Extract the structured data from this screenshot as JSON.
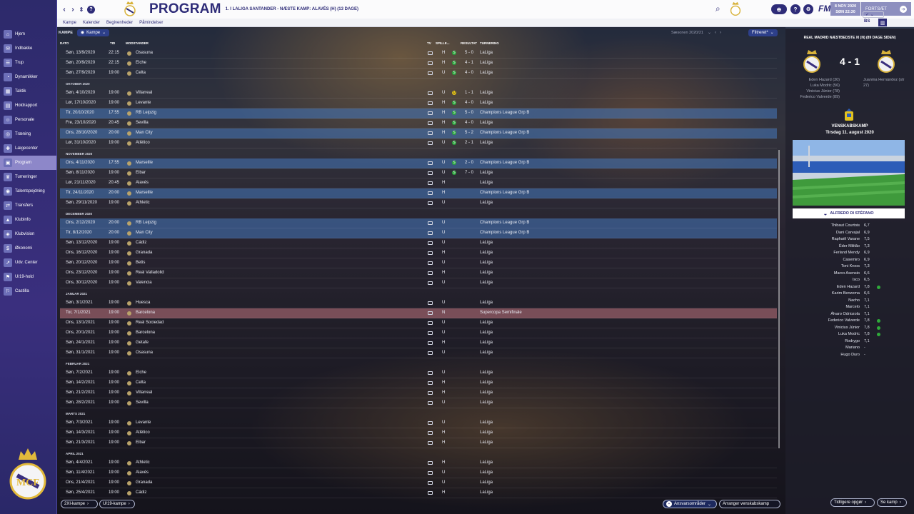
{
  "header": {
    "title": "PROGRAM",
    "subtitle": "1. I LALIGA SANTANDER - NÆSTE KAMP: ALAVÉS (H) (13 DAGE)",
    "date_line1": "8 NOV 2020",
    "date_line2": "SØN 22:30",
    "continue_label": "FORTSÆT",
    "fm_label": "FM",
    "bs_label": "BS"
  },
  "subnav": [
    "Kampe",
    "Kalender",
    "Begivenheder",
    "Påmindelser"
  ],
  "toolbar": {
    "kampe_label": "KAMPE",
    "kampe_dropdown": "Kampe",
    "season": "Sæsonen 2020/21",
    "filter": "Filtreret*"
  },
  "columns": {
    "date": "DATO",
    "time": "TID",
    "opponent": "MODSTANDER",
    "tv": "TV",
    "venue": "SPILLE...",
    "result": "RESULTAT",
    "comp": "TURNERING"
  },
  "sidebar": [
    {
      "label": "Hjem",
      "icon": "home-icon"
    },
    {
      "label": "Indbakke",
      "icon": "inbox-icon"
    },
    {
      "label": "Trup",
      "icon": "squad-icon"
    },
    {
      "label": "Dynamikker",
      "icon": "dynamics-icon"
    },
    {
      "label": "Taktik",
      "icon": "tactics-icon"
    },
    {
      "label": "Holdrapport",
      "icon": "report-icon"
    },
    {
      "label": "Personale",
      "icon": "staff-icon"
    },
    {
      "label": "Træning",
      "icon": "training-icon"
    },
    {
      "label": "Lægecenter",
      "icon": "medical-icon"
    },
    {
      "label": "Program",
      "icon": "calendar-icon"
    },
    {
      "label": "Turneringer",
      "icon": "trophy-icon"
    },
    {
      "label": "Talentspejdning",
      "icon": "scouting-icon"
    },
    {
      "label": "Transfers",
      "icon": "transfer-icon"
    },
    {
      "label": "Klubinfo",
      "icon": "club-icon"
    },
    {
      "label": "Klubvision",
      "icon": "vision-icon"
    },
    {
      "label": "Økonomi",
      "icon": "finance-icon"
    },
    {
      "label": "Udv. Center",
      "icon": "development-icon"
    },
    {
      "label": "U/19-hold",
      "icon": "youth-icon"
    },
    {
      "label": "Castilla",
      "icon": "reserve-icon"
    }
  ],
  "rows": [
    {
      "date": "Søn, 13/9/2020",
      "time": "22:15",
      "opp": "Osasuna",
      "venue": "H",
      "res": "5 - 0",
      "out": "w",
      "comp": "LaLiga"
    },
    {
      "date": "Søn, 20/9/2020",
      "time": "22:15",
      "opp": "Elche",
      "venue": "H",
      "res": "4 - 1",
      "out": "w",
      "comp": "LaLiga"
    },
    {
      "date": "Søn, 27/9/2020",
      "time": "19:00",
      "opp": "Celta",
      "venue": "U",
      "res": "4 - 0",
      "out": "w",
      "comp": "LaLiga"
    },
    {
      "month": "OKTOBER 2020"
    },
    {
      "date": "Søn, 4/10/2020",
      "time": "19:00",
      "opp": "Villarreal",
      "venue": "U",
      "res": "1 - 1",
      "out": "d",
      "comp": "LaLiga"
    },
    {
      "date": "Lør, 17/10/2020",
      "time": "19:00",
      "opp": "Levante",
      "venue": "H",
      "res": "4 - 0",
      "out": "w",
      "comp": "LaLiga"
    },
    {
      "date": "Tir, 20/10/2020",
      "time": "17:55",
      "opp": "RB Leipzig",
      "venue": "H",
      "res": "5 - 0",
      "out": "w",
      "comp": "Champions League Grp B",
      "hl": "blue"
    },
    {
      "date": "Fre, 23/10/2020",
      "time": "20:45",
      "opp": "Sevilla",
      "venue": "H",
      "res": "4 - 0",
      "out": "w",
      "comp": "LaLiga"
    },
    {
      "date": "Ons, 28/10/2020",
      "time": "20:00",
      "opp": "Man City",
      "venue": "H",
      "res": "5 - 2",
      "out": "w",
      "comp": "Champions League Grp B",
      "hl": "blue"
    },
    {
      "date": "Lør, 31/10/2020",
      "time": "19:00",
      "opp": "Atlético",
      "venue": "U",
      "res": "2 - 1",
      "out": "w",
      "comp": "LaLiga"
    },
    {
      "month": "NOVEMBER 2020"
    },
    {
      "date": "Ons, 4/11/2020",
      "time": "17:55",
      "opp": "Marseille",
      "venue": "U",
      "res": "2 - 0",
      "out": "w",
      "comp": "Champions League Grp B",
      "hl": "blue"
    },
    {
      "date": "Søn, 8/11/2020",
      "time": "19:00",
      "opp": "Eibar",
      "venue": "U",
      "res": "7 - 0",
      "out": "w",
      "comp": "LaLiga"
    },
    {
      "date": "Lør, 21/11/2020",
      "time": "20:45",
      "opp": "Alavés",
      "venue": "H",
      "res": "",
      "out": "",
      "comp": "LaLiga"
    },
    {
      "date": "Tir, 24/11/2020",
      "time": "20:00",
      "opp": "Marseille",
      "venue": "H",
      "res": "",
      "out": "",
      "comp": "Champions League Grp B",
      "hl": "blue"
    },
    {
      "date": "Søn, 29/11/2020",
      "time": "19:00",
      "opp": "Athletic",
      "venue": "U",
      "res": "",
      "out": "",
      "comp": "LaLiga"
    },
    {
      "month": "DECEMBER 2020"
    },
    {
      "date": "Ons, 2/12/2020",
      "time": "20:00",
      "opp": "RB Leipzig",
      "venue": "U",
      "res": "",
      "out": "",
      "comp": "Champions League Grp B",
      "hl": "blue"
    },
    {
      "date": "Tir, 8/12/2020",
      "time": "20:00",
      "opp": "Man City",
      "venue": "U",
      "res": "",
      "out": "",
      "comp": "Champions League Grp B",
      "hl": "blue"
    },
    {
      "date": "Søn, 13/12/2020",
      "time": "19:00",
      "opp": "Cádiz",
      "venue": "U",
      "res": "",
      "out": "",
      "comp": "LaLiga"
    },
    {
      "date": "Ons, 16/12/2020",
      "time": "19:00",
      "opp": "Granada",
      "venue": "H",
      "res": "",
      "out": "",
      "comp": "LaLiga"
    },
    {
      "date": "Søn, 20/12/2020",
      "time": "19:00",
      "opp": "Betis",
      "venue": "U",
      "res": "",
      "out": "",
      "comp": "LaLiga"
    },
    {
      "date": "Ons, 23/12/2020",
      "time": "19:00",
      "opp": "Real Valladolid",
      "venue": "H",
      "res": "",
      "out": "",
      "comp": "LaLiga"
    },
    {
      "date": "Ons, 30/12/2020",
      "time": "19:00",
      "opp": "Valencia",
      "venue": "U",
      "res": "",
      "out": "",
      "comp": "LaLiga"
    },
    {
      "month": "JANUAR 2021"
    },
    {
      "date": "Søn, 3/1/2021",
      "time": "19:00",
      "opp": "Huesca",
      "venue": "U",
      "res": "",
      "out": "",
      "comp": "LaLiga"
    },
    {
      "date": "Tor, 7/1/2021",
      "time": "19:00",
      "opp": "Barcelona",
      "venue": "N",
      "res": "",
      "out": "",
      "comp": "Supercopa Semifinale",
      "hl": "pink"
    },
    {
      "date": "Ons, 13/1/2021",
      "time": "19:00",
      "opp": "Real Sociedad",
      "venue": "U",
      "res": "",
      "out": "",
      "comp": "LaLiga"
    },
    {
      "date": "Ons, 20/1/2021",
      "time": "19:00",
      "opp": "Barcelona",
      "venue": "U",
      "res": "",
      "out": "",
      "comp": "LaLiga"
    },
    {
      "date": "Søn, 24/1/2021",
      "time": "19:00",
      "opp": "Getafe",
      "venue": "H",
      "res": "",
      "out": "",
      "comp": "LaLiga"
    },
    {
      "date": "Søn, 31/1/2021",
      "time": "19:00",
      "opp": "Osasuna",
      "venue": "U",
      "res": "",
      "out": "",
      "comp": "LaLiga"
    },
    {
      "month": "FEBRUAR 2021"
    },
    {
      "date": "Søn, 7/2/2021",
      "time": "19:00",
      "opp": "Elche",
      "venue": "U",
      "res": "",
      "out": "",
      "comp": "LaLiga"
    },
    {
      "date": "Søn, 14/2/2021",
      "time": "19:00",
      "opp": "Celta",
      "venue": "H",
      "res": "",
      "out": "",
      "comp": "LaLiga"
    },
    {
      "date": "Søn, 21/2/2021",
      "time": "19:00",
      "opp": "Villarreal",
      "venue": "H",
      "res": "",
      "out": "",
      "comp": "LaLiga"
    },
    {
      "date": "Søn, 28/2/2021",
      "time": "19:00",
      "opp": "Sevilla",
      "venue": "U",
      "res": "",
      "out": "",
      "comp": "LaLiga"
    },
    {
      "month": "MARTS 2021"
    },
    {
      "date": "Søn, 7/3/2021",
      "time": "19:00",
      "opp": "Levante",
      "venue": "U",
      "res": "",
      "out": "",
      "comp": "LaLiga"
    },
    {
      "date": "Søn, 14/3/2021",
      "time": "19:00",
      "opp": "Atlético",
      "venue": "H",
      "res": "",
      "out": "",
      "comp": "LaLiga"
    },
    {
      "date": "Søn, 21/3/2021",
      "time": "19:00",
      "opp": "Eibar",
      "venue": "H",
      "res": "",
      "out": "",
      "comp": "LaLiga"
    },
    {
      "month": "APRIL 2021"
    },
    {
      "date": "Søn, 4/4/2021",
      "time": "19:00",
      "opp": "Athletic",
      "venue": "H",
      "res": "",
      "out": "",
      "comp": "LaLiga"
    },
    {
      "date": "Søn, 11/4/2021",
      "time": "19:00",
      "opp": "Alavés",
      "venue": "U",
      "res": "",
      "out": "",
      "comp": "LaLiga"
    },
    {
      "date": "Ons, 21/4/2021",
      "time": "19:00",
      "opp": "Granada",
      "venue": "U",
      "res": "",
      "out": "",
      "comp": "LaLiga"
    },
    {
      "date": "Søn, 25/4/2021",
      "time": "19:00",
      "opp": "Cádiz",
      "venue": "H",
      "res": "",
      "out": "",
      "comp": "LaLiga"
    }
  ],
  "panel": {
    "title": "REAL MADRID NÆSTBEDSTE XI (N) (89 DAGE SIDEN)",
    "score": "4 - 1",
    "home_scorers": [
      "Eden Hazard (30)",
      "Luka Modric (56)",
      "Vinicius Júnior (78)",
      "Federico Valverde (89)"
    ],
    "away_scorers": [
      "Juanma Hernández (str",
      "27)"
    ],
    "match_type": "VENSKABSKAMP",
    "match_date": "Tirsdag 11. august 2020",
    "stadium": "ALFREDO DI STÉFANO",
    "players": [
      {
        "name": "Thibaut Courtois",
        "rating": "6,7",
        "goal": false
      },
      {
        "name": "Dani Carvajal",
        "rating": "6,9",
        "goal": false
      },
      {
        "name": "Raphaël Varane",
        "rating": "7,5",
        "goal": false
      },
      {
        "name": "Éder Militão",
        "rating": "7,3",
        "goal": false
      },
      {
        "name": "Ferland Mendy",
        "rating": "6,9",
        "goal": false
      },
      {
        "name": "Casemiro",
        "rating": "6,9",
        "goal": false
      },
      {
        "name": "Toni Kroos",
        "rating": "7,3",
        "goal": false
      },
      {
        "name": "Marco Asensio",
        "rating": "6,6",
        "goal": false
      },
      {
        "name": "Isco",
        "rating": "6,5",
        "goal": false
      },
      {
        "name": "Eden Hazard",
        "rating": "7,8",
        "goal": true
      },
      {
        "name": "Karim Benzema",
        "rating": "6,6",
        "goal": false
      },
      {
        "name": "Nacho",
        "rating": "7,1",
        "goal": false
      },
      {
        "name": "Marcelo",
        "rating": "7,1",
        "goal": false
      },
      {
        "name": "Álvaro Odriozola",
        "rating": "7,1",
        "goal": false
      },
      {
        "name": "Federico Valverde",
        "rating": "7,8",
        "goal": true
      },
      {
        "name": "Vinicius Júnior",
        "rating": "7,8",
        "goal": true
      },
      {
        "name": "Luka Modric",
        "rating": "7,8",
        "goal": true
      },
      {
        "name": "Rodrygo",
        "rating": "7,1",
        "goal": false
      },
      {
        "name": "Mariano",
        "rating": "-",
        "goal": false
      },
      {
        "name": "Hugo Duro",
        "rating": "-",
        "goal": false
      }
    ]
  },
  "bottom": {
    "btn1": "2XI-kampe",
    "btn2": "U/19-kampe",
    "btn3": "Ansvarsområder",
    "btn4": "Arranger venskabskamp",
    "btn5": "Tidligere opgør",
    "btn6": "Se kamp"
  },
  "colors": {
    "accent": "#2e2c78",
    "win": "#29a43b",
    "draw": "#e3c21a",
    "cl_row": "#4678be",
    "cup_row": "#b46e78"
  }
}
